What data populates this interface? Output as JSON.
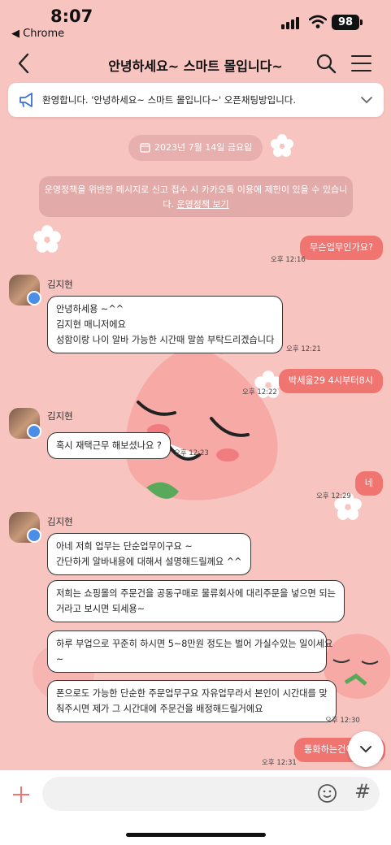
{
  "status_bar": {
    "time": "8:07",
    "back_app": "◀ Chrome",
    "battery": "98"
  },
  "header": {
    "title": "안녕하세요~ 스마트 몰입니다~"
  },
  "notice": {
    "text": "환영합니다. '안녕하세요~ 스마트 몰입니다~' 오픈채팅방입니다."
  },
  "date": {
    "label": "2023년 7월 14일 금요일"
  },
  "policy": {
    "line1": "운영정책을 위반한 메시지로 신고 접수 시 카카오톡 이용에 제한이 있을 수 있습니",
    "line2_prefix": "다. ",
    "link": "운영정책 보기"
  },
  "messages": [
    {
      "text": "무슨업무인가요?",
      "time": "오후 12:16"
    },
    {
      "sender": "김지현",
      "text": "안녕하세용 ~^^\n김지현 매니저에요\n성함이랑 나이 알바 가능한 시간때 말씀 부탁드리겠습니다",
      "time": "오후 12:21"
    },
    {
      "text": "박세울29    4시부터8시",
      "time": "오후 12:22"
    },
    {
      "sender": "김지현",
      "text": "혹시 재택근무 해보셨나요 ?",
      "time": "오후 12:23"
    },
    {
      "text": "네",
      "time": "오후 12:29"
    },
    {
      "sender": "김지현",
      "texts": [
        "아네 저희 업무는 단순업무이구요 ~\n간단하게 알바내용에 대해서 설명해드릴께요 ^^",
        "저희는 쇼핑몰의 주문건을 공동구매로 물류회사에 대리주문을 넣으면 되는\n거라고 보시면 되세용~",
        "하루 부업으로 꾸준히 하시면 5~8만원 정도는 벌어 가실수있는 일이세요\n~",
        "폰으로도 가능한 단순한 주문업무구요 자유업무라서 본인이 시간대를 맞\n춰주시면 제가 그 시간대에 주문건을 배정해드릴거에요"
      ],
      "time": "오후 12:30"
    },
    {
      "text": "통화하는건이",
      "time": "오후 12:31"
    }
  ],
  "input": {
    "placeholder": ""
  },
  "colors": {
    "background": "#f7c4c0",
    "my_bubble": "#f07470",
    "accent": "#f07470"
  }
}
